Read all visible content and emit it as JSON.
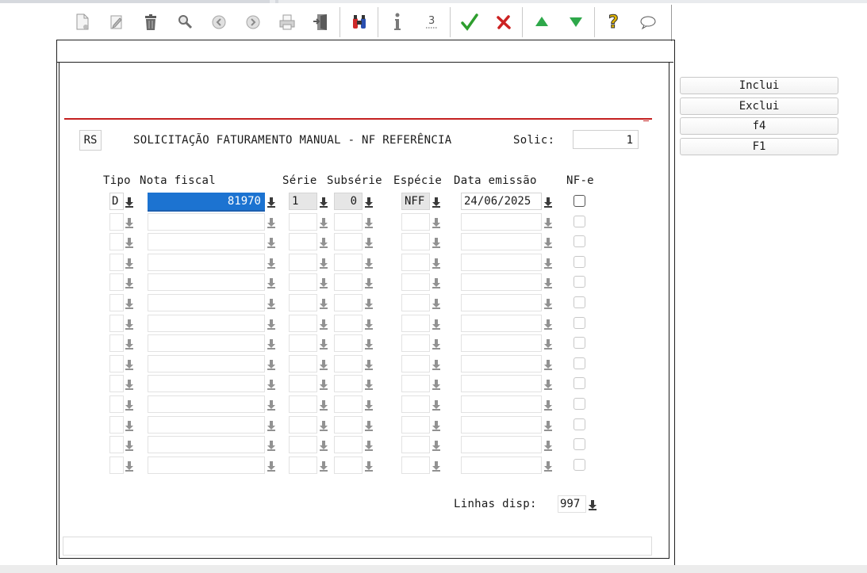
{
  "toolbar": {
    "icons": [
      "new-doc-icon",
      "edit-icon",
      "trash-icon",
      "search-icon",
      "prev-icon",
      "next-icon",
      "print-icon",
      "exit-icon",
      "binoculars-icon",
      "info-icon",
      "count-icon",
      "confirm-icon",
      "cancel-icon",
      "up-icon",
      "down-icon",
      "help-icon",
      "comment-icon"
    ]
  },
  "header": {
    "code": "RS",
    "title": "SOLICITAÇÃO FATURAMENTO MANUAL - NF REFERÊNCIA",
    "solic_label": "Solic:",
    "solic_value": "1"
  },
  "columns": {
    "tipo": "Tipo",
    "nota": "Nota fiscal",
    "serie": "Série",
    "subserie": "Subsérie",
    "especie": "Espécie",
    "data": "Data emissão",
    "nfe": "NF-e"
  },
  "rows": [
    {
      "tipo": "D",
      "nota": "81970",
      "serie": "1",
      "subserie": "0",
      "especie": "NFF",
      "data": "24/06/2025",
      "nfe": false
    }
  ],
  "empty_rows": 13,
  "buttons": {
    "inclui": "Inclui",
    "exclui": "Exclui",
    "f4": "f4",
    "f1": "F1"
  },
  "footer": {
    "linhas_label": "Linhas disp:",
    "linhas_value": "997"
  },
  "colors": {
    "selection": "#1c73d1",
    "separator_red": "#c42020",
    "confirm_green": "#2e9e2e",
    "cancel_red": "#cc2222"
  }
}
